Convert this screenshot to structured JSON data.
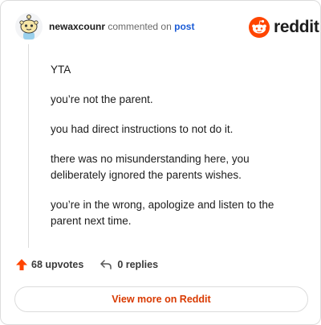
{
  "header": {
    "username": "newaxcounr",
    "action": "commented on",
    "post_link": "post",
    "brand": "reddit"
  },
  "comment": {
    "paragraphs": [
      "YTA",
      "you’re not the parent.",
      "you had direct instructions to not do it.",
      "there was no misunderstanding here, you deliberately ignored the parents wishes.",
      "you’re in the wrong, apologize and listen to the parent next time."
    ]
  },
  "actions": {
    "upvotes": "68 upvotes",
    "replies": "0 replies"
  },
  "footer": {
    "view_more": "View more on Reddit"
  },
  "colors": {
    "brand_orange": "#ff4500",
    "upvote": "#ff4500",
    "link_blue": "#1a5bd6",
    "view_more": "#d93a00"
  },
  "icons": {
    "avatar": "snoo-avatar-icon",
    "logo": "reddit-logo-icon",
    "upvote": "upvote-arrow-icon",
    "reply": "reply-arrow-icon"
  }
}
